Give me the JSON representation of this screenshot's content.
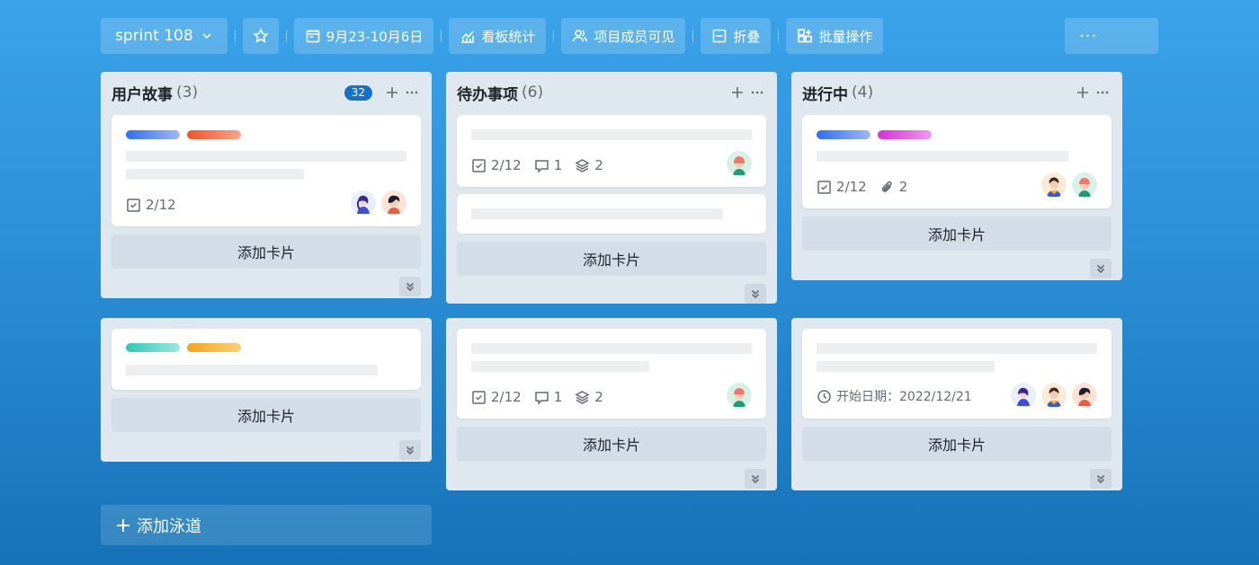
{
  "toolbar": {
    "sprint_label": "sprint 108",
    "date_range": "9月23-10月6日",
    "stats": "看板统计",
    "visibility": "项目成员可见",
    "collapse": "折叠",
    "batch": "批量操作",
    "more": "···"
  },
  "columns": [
    {
      "title": "用户故事",
      "count": "(3)",
      "badge": "32"
    },
    {
      "title": "待办事项",
      "count": "(6)"
    },
    {
      "title": "进行中",
      "count": "(4)"
    }
  ],
  "cards": {
    "c1": {
      "checklist": "2/12"
    },
    "c2": {
      "checklist": "2/12",
      "comments": "1",
      "subtasks": "2"
    },
    "c3": {
      "checklist": "2/12",
      "attachments": "2"
    },
    "c4": {
      "checklist": "2/12",
      "comments": "1",
      "subtasks": "2"
    },
    "c5": {
      "start_date": "开始日期：2022/12/21"
    }
  },
  "add_card_label": "添加卡片",
  "add_lane_label": "添加泳道",
  "colors": {
    "blue_tag": "#2f6ef0",
    "red_tag": "#f0532a",
    "magenta_tag": "#d62fd6",
    "teal_tag": "#2fc9b8",
    "orange_tag": "#f5a21a",
    "badge": "#1473c9"
  }
}
